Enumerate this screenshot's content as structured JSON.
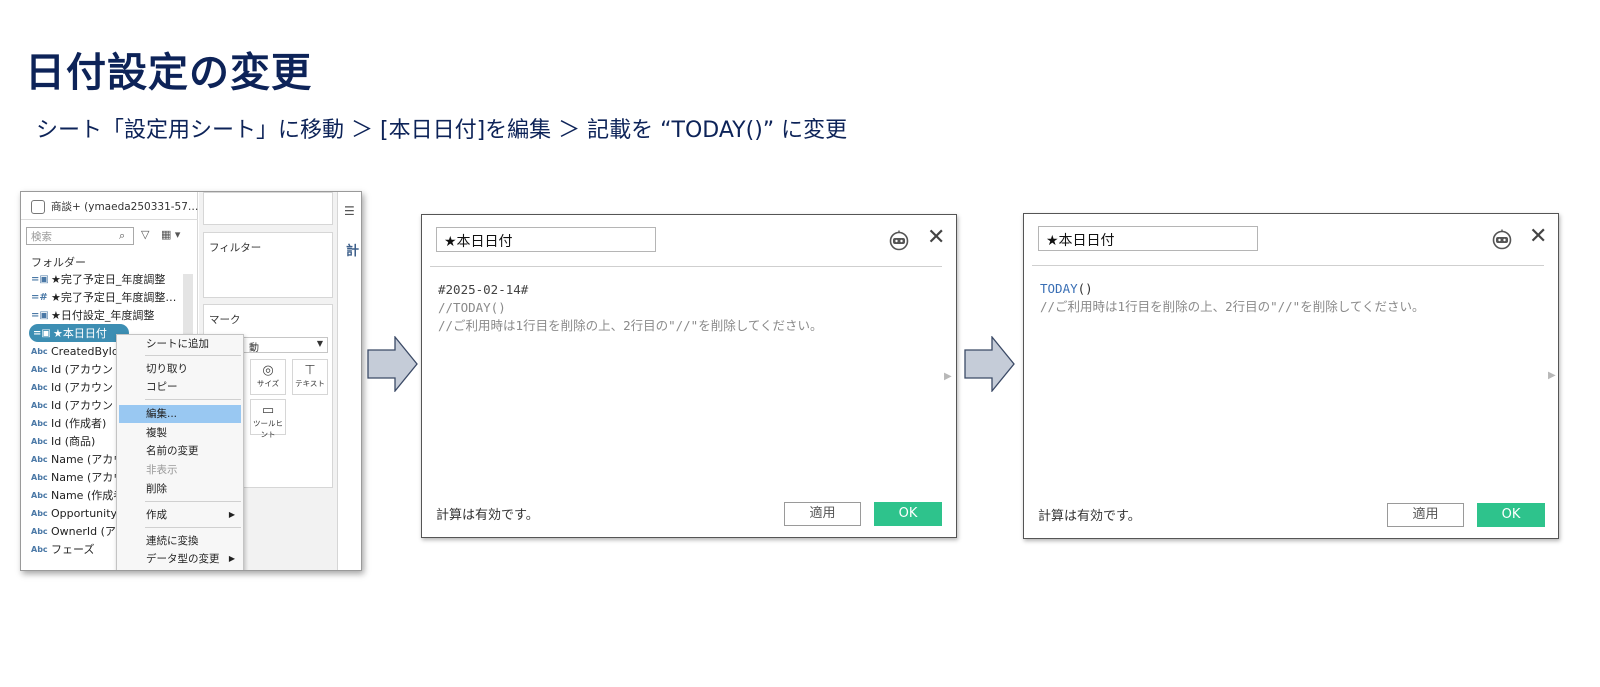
{
  "slide": {
    "title": "日付設定の変更",
    "subtitle": "シート「設定用シート」に移動 ＞ [本日日付]を編集 ＞ 記載を “TODAY()” に変更"
  },
  "tableau": {
    "datasource": "商談+ (ymaeda250331-57…",
    "search_placeholder": "検索",
    "folders_label": "フォルダー",
    "fields": [
      {
        "icon": "calc-date-icon",
        "type_glyph": "=📅",
        "label": "★完了予定日_年度調整"
      },
      {
        "icon": "calc-number-icon",
        "type_glyph": "=#",
        "label": "★完了予定日_年度調整…"
      },
      {
        "icon": "calc-date-icon",
        "type_glyph": "=📅",
        "label": "★日付設定_年度調整"
      },
      {
        "icon": "calc-date-icon",
        "type_glyph": "=📅",
        "label": "★本日日付"
      },
      {
        "icon": "string-icon",
        "type_glyph": "Abc",
        "label": "CreatedById ("
      },
      {
        "icon": "string-icon",
        "type_glyph": "Abc",
        "label": "Id (アカウント)"
      },
      {
        "icon": "string-icon",
        "type_glyph": "Abc",
        "label": "Id (アカウントの"
      },
      {
        "icon": "string-icon",
        "type_glyph": "Abc",
        "label": "Id (アカウントの"
      },
      {
        "icon": "string-icon",
        "type_glyph": "Abc",
        "label": "Id (作成者)"
      },
      {
        "icon": "string-icon",
        "type_glyph": "Abc",
        "label": "Id (商品)"
      },
      {
        "icon": "string-icon",
        "type_glyph": "Abc",
        "label": "Name (アカウン"
      },
      {
        "icon": "string-icon",
        "type_glyph": "Abc",
        "label": "Name (アカウン"
      },
      {
        "icon": "string-icon",
        "type_glyph": "Abc",
        "label": "Name (作成者"
      },
      {
        "icon": "string-icon",
        "type_glyph": "Abc",
        "label": "OpportunityId"
      },
      {
        "icon": "string-icon",
        "type_glyph": "Abc",
        "label": "OwnerId (アカ"
      },
      {
        "icon": "string-icon",
        "type_glyph": "Abc",
        "label": "フェーズ"
      }
    ],
    "filters_label": "フィルター",
    "marks_label": "マーク",
    "mark_type": "動",
    "mark_buttons": [
      {
        "glyph": "◎",
        "label": "サイズ"
      },
      {
        "glyph": "T",
        "label": "テキスト"
      },
      {
        "glyph": "💬",
        "label": "ツールヒント"
      }
    ],
    "side_text": "計",
    "context_menu": [
      {
        "label": "シートに追加",
        "state": "normal"
      },
      {
        "label": "切り取り",
        "state": "normal"
      },
      {
        "label": "コピー",
        "state": "normal"
      },
      {
        "label": "編集...",
        "state": "active"
      },
      {
        "label": "複製",
        "state": "normal"
      },
      {
        "label": "名前の変更",
        "state": "normal"
      },
      {
        "label": "非表示",
        "state": "disabled"
      },
      {
        "label": "削除",
        "state": "normal"
      },
      {
        "label": "作成",
        "state": "submenu"
      },
      {
        "label": "連続に変換",
        "state": "normal"
      },
      {
        "label": "データ型の変更",
        "state": "submenu"
      }
    ]
  },
  "dialog_before": {
    "name": "★本日日付",
    "code_line1": "#2025-02-14#",
    "code_line2": "//TODAY()",
    "code_line3": "//ご利用時は1行目を削除の上、2行目の\"//\"を削除してください。",
    "status": "計算は有効です。",
    "apply_label": "適用",
    "ok_label": "OK"
  },
  "dialog_after": {
    "name": "★本日日付",
    "code_func": "TODAY",
    "code_paren": "()",
    "code_line2": "//ご利用時は1行目を削除の上、2行目の\"//\"を削除してください。",
    "status": "計算は有効です。",
    "apply_label": "適用",
    "ok_label": "OK"
  },
  "colors": {
    "title": "#0d2358",
    "ok_button": "#2ec38c",
    "selection": "#3d8eb3",
    "menu_highlight": "#99c8f2",
    "arrow_fill": "#c5ccd8"
  }
}
